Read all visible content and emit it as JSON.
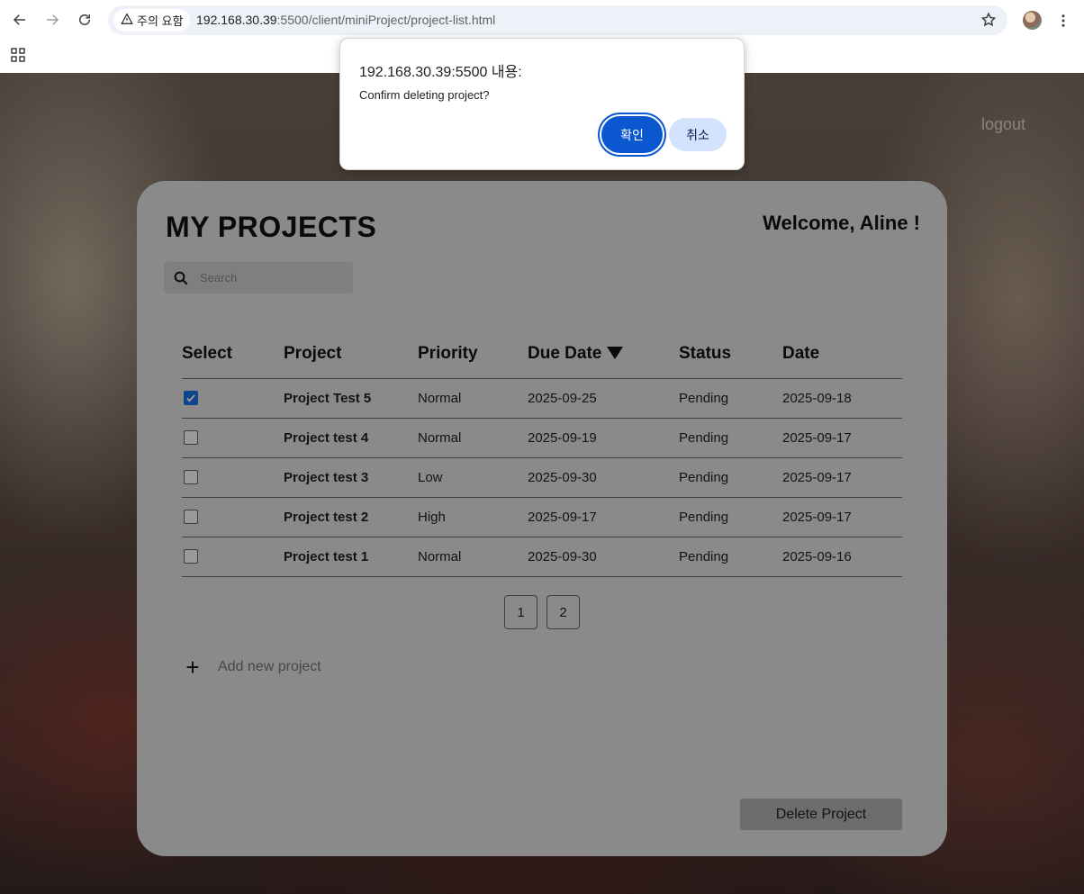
{
  "browser": {
    "security_label": "주의 요함",
    "url_host": "192.168.30.39",
    "url_rest": ":5500/client/miniProject/project-list.html"
  },
  "page": {
    "logout_label": "logout",
    "title": "MY PROJECTS",
    "welcome": "Welcome, Aline !",
    "search": {
      "placeholder": "Search",
      "value": ""
    },
    "columns": [
      "Select",
      "Project",
      "Priority",
      "Due Date",
      "Status",
      "Date"
    ],
    "rows": [
      {
        "checked": true,
        "project": "Project Test 5",
        "priority": "Normal",
        "due_date": "2025-09-25",
        "status": "Pending",
        "date": "2025-09-18"
      },
      {
        "checked": false,
        "project": "Project test 4",
        "priority": "Normal",
        "due_date": "2025-09-19",
        "status": "Pending",
        "date": "2025-09-17"
      },
      {
        "checked": false,
        "project": "Project test 3",
        "priority": "Low",
        "due_date": "2025-09-30",
        "status": "Pending",
        "date": "2025-09-17"
      },
      {
        "checked": false,
        "project": "Project test 2",
        "priority": "High",
        "due_date": "2025-09-17",
        "status": "Pending",
        "date": "2025-09-17"
      },
      {
        "checked": false,
        "project": "Project test 1",
        "priority": "Normal",
        "due_date": "2025-09-30",
        "status": "Pending",
        "date": "2025-09-16"
      }
    ],
    "pages": [
      "1",
      "2"
    ],
    "add_project_label": "Add new project",
    "delete_button_label": "Delete Project"
  },
  "dialog": {
    "title": "192.168.30.39:5500 내용:",
    "message": "Confirm deleting project?",
    "ok_label": "확인",
    "cancel_label": "취소"
  },
  "icons": {
    "back": "back-arrow-icon",
    "forward": "forward-arrow-icon",
    "reload": "reload-icon",
    "warning": "warning-icon",
    "bookmark": "star-icon",
    "menu": "kebab-menu-icon",
    "apps": "apps-grid-icon",
    "search": "search-icon",
    "sort": "sort-down-icon",
    "add": "plus-icon"
  },
  "colors": {
    "primary_button": "#0b57d0",
    "secondary_button": "#d3e3fd",
    "checkbox_checked": "#1a73e8"
  }
}
